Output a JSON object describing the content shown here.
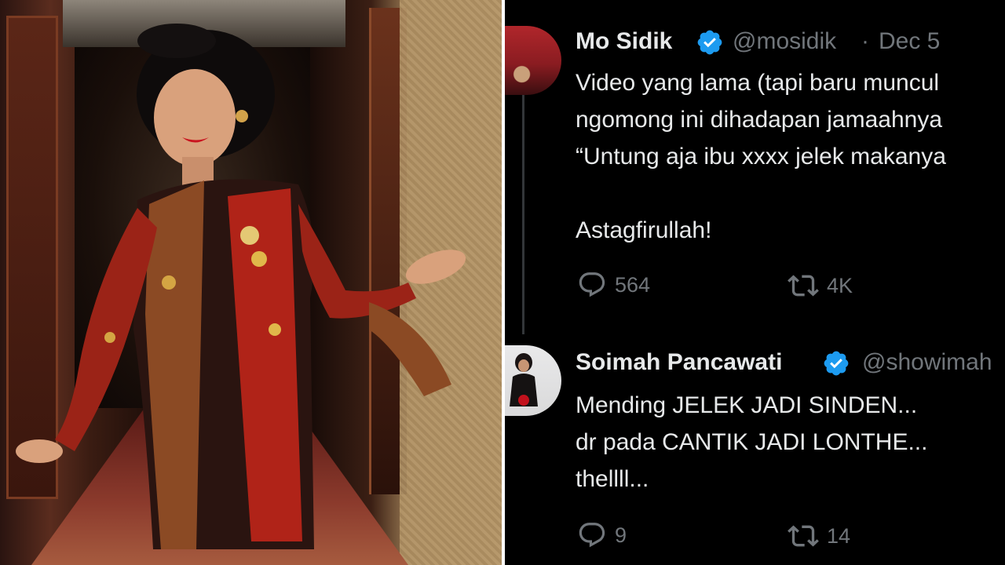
{
  "tweet1": {
    "name": "Mo Sidik",
    "handle": "@mosidik",
    "separator": "·",
    "date": "Dec 5",
    "lines": [
      "Video yang lama (tapi baru muncul",
      "ngomong ini dihadapan jamaahnya",
      "“Untung aja ibu xxxx jelek makanya",
      "",
      "Astagfirullah!"
    ],
    "replies": "564",
    "reposts": "4K"
  },
  "tweet2": {
    "name": "Soimah Pancawati",
    "handle": "@showimah",
    "lines": [
      "Mending JELEK JADI SINDEN...",
      "dr pada CANTIK JADI LONTHE...",
      "thellll..."
    ],
    "replies": "9",
    "reposts": "14"
  },
  "colors": {
    "background": "#000000",
    "text": "#e7e9ea",
    "muted": "#71767b",
    "verified": "#1d9bf0"
  },
  "icons": {
    "verified": "verified-badge-icon",
    "reply": "reply-icon",
    "repost": "repost-icon"
  }
}
